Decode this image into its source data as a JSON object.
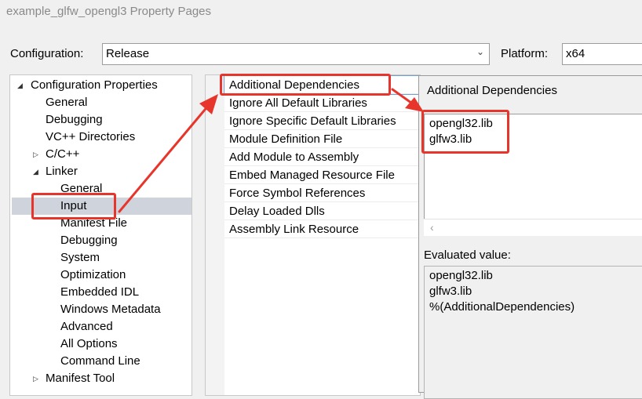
{
  "window": {
    "title": "example_glfw_opengl3 Property Pages"
  },
  "header": {
    "configuration_label": "Configuration:",
    "configuration_value": "Release",
    "platform_label": "Platform:",
    "platform_value": "x64"
  },
  "tree": {
    "root": "Configuration Properties",
    "general": "General",
    "debugging": "Debugging",
    "vc_dirs": "VC++ Directories",
    "cpp": "C/C++",
    "linker": "Linker",
    "linker_items": [
      "General",
      "Input",
      "Manifest File",
      "Debugging",
      "System",
      "Optimization",
      "Embedded IDL",
      "Windows Metadata",
      "Advanced",
      "All Options",
      "Command Line"
    ],
    "manifest_tool": "Manifest Tool"
  },
  "properties": [
    "Additional Dependencies",
    "Ignore All Default Libraries",
    "Ignore Specific Default Libraries",
    "Module Definition File",
    "Add Module to Assembly",
    "Embed Managed Resource File",
    "Force Symbol References",
    "Delay Loaded Dlls",
    "Assembly Link Resource"
  ],
  "dialog": {
    "title": "Additional Dependencies",
    "lines": [
      "opengl32.lib",
      "glfw3.lib"
    ],
    "evaluated_label": "Evaluated value:",
    "evaluated_lines": [
      "opengl32.lib",
      "glfw3.lib",
      "%(AdditionalDependencies)"
    ]
  },
  "annotation_color": "#e8352c"
}
